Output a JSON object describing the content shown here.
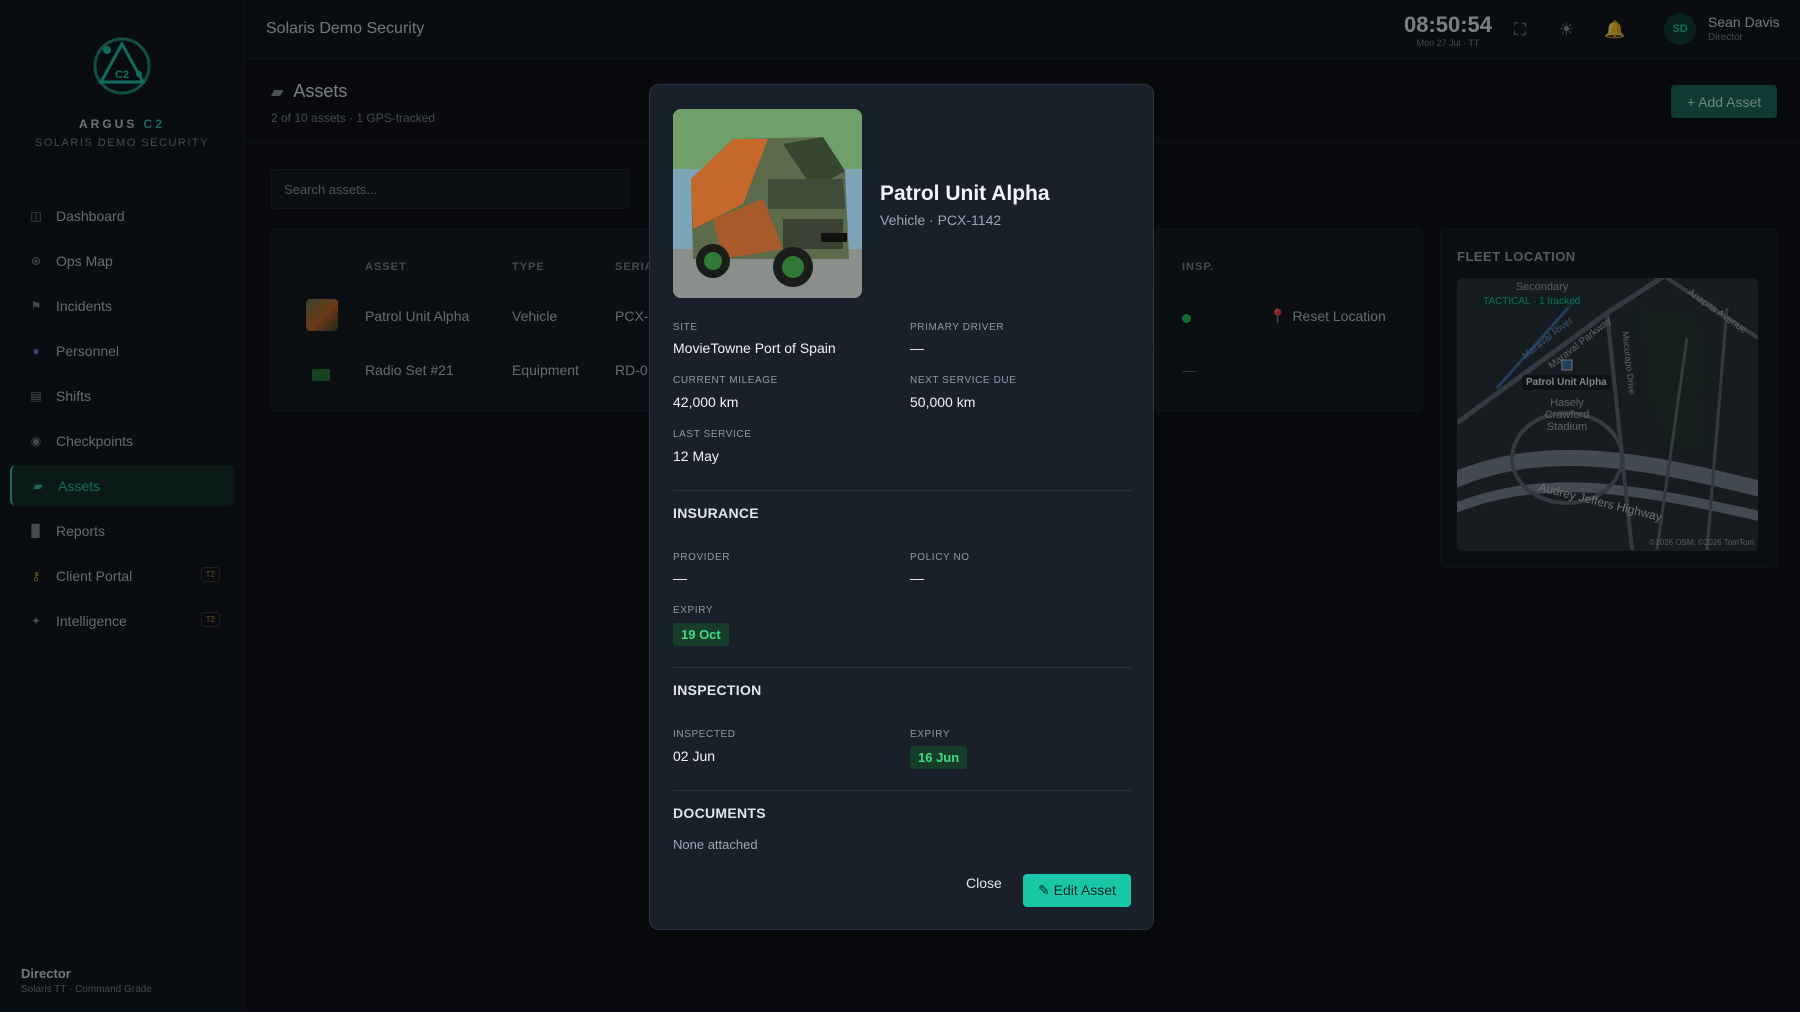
{
  "app": {
    "title": "Solaris Demo Security"
  },
  "brand": {
    "name": "ARGUS",
    "name_accent": "C2",
    "subtitle": "SOLARIS DEMO SECURITY"
  },
  "sidebar": {
    "items": [
      {
        "label": "Dashboard",
        "icon": "dashboard-icon"
      },
      {
        "label": "Ops Map",
        "icon": "globe-icon"
      },
      {
        "label": "Incidents",
        "icon": "flag-icon"
      },
      {
        "label": "Personnel",
        "icon": "person-icon"
      },
      {
        "label": "Shifts",
        "icon": "calendar-icon"
      },
      {
        "label": "Checkpoints",
        "icon": "target-icon"
      },
      {
        "label": "Assets",
        "icon": "vehicle-icon",
        "active": true
      },
      {
        "label": "Reports",
        "icon": "document-icon"
      },
      {
        "label": "Client Portal",
        "icon": "key-icon",
        "badge": "T2"
      },
      {
        "label": "Intelligence",
        "icon": "sparkle-icon",
        "badge": "T2"
      }
    ],
    "footer": {
      "role": "Director",
      "org": "Solaris TT · Command Grade"
    }
  },
  "topbar": {
    "time": "08:50:54",
    "date": "Mon 27 Jul · TT",
    "user": {
      "initials": "SD",
      "name": "Sean Davis",
      "role": "Director"
    }
  },
  "page": {
    "title": "Assets",
    "subtitle": "2 of 10 assets · 1 GPS-tracked",
    "add_button": "+ Add Asset",
    "search_placeholder": "Search assets..."
  },
  "table": {
    "headers": {
      "asset": "ASSET",
      "type": "TYPE",
      "serial": "SERIA",
      "insp": "INSP."
    },
    "rows": [
      {
        "name": "Patrol Unit Alpha",
        "type": "Vehicle",
        "serial": "PCX-",
        "action": "Reset Location"
      },
      {
        "name": "Radio Set #21",
        "type": "Equipment",
        "serial": "RD-0",
        "insp": "—"
      }
    ]
  },
  "fleet": {
    "title": "FLEET LOCATION",
    "map": {
      "label": "Patrol Unit Alpha",
      "tag": "TACTICAL · 1 tracked",
      "streets": [
        "Secondary",
        "Ariapita Avenue",
        "Maraval River",
        "Maraval Parkway",
        "Hasely Crawford Stadium",
        "Audrey Jeffers Highway",
        "Mucurapo Drive"
      ],
      "attribution": "©2026 OSM, ©2026 TomTom"
    }
  },
  "modal": {
    "name": "Patrol Unit Alpha",
    "subtitle": "Vehicle · PCX-1142",
    "site_label": "SITE",
    "site": "MovieTowne Port of Spain",
    "driver_label": "PRIMARY DRIVER",
    "driver": "—",
    "mileage_label": "CURRENT MILEAGE",
    "mileage": "42,000 km",
    "next_service_label": "NEXT SERVICE DUE",
    "next_service": "50,000 km",
    "last_service_label": "LAST SERVICE",
    "last_service": "12 May",
    "insurance": {
      "title": "INSURANCE",
      "provider_label": "PROVIDER",
      "provider": "—",
      "policy_label": "POLICY NO",
      "policy": "—",
      "expiry_label": "EXPIRY",
      "expiry": "19 Oct"
    },
    "inspection": {
      "title": "INSPECTION",
      "inspected_label": "INSPECTED",
      "inspected": "02 Jun",
      "expiry_label": "EXPIRY",
      "expiry": "16 Jun"
    },
    "documents": {
      "title": "DOCUMENTS",
      "empty": "None attached"
    },
    "close": "Close",
    "edit": "✎ Edit Asset"
  },
  "colors": {
    "accent": "#22c5a6",
    "background": "#0f1319",
    "pill_green": "#3ddc84",
    "edit_button": "#18c7a8"
  }
}
